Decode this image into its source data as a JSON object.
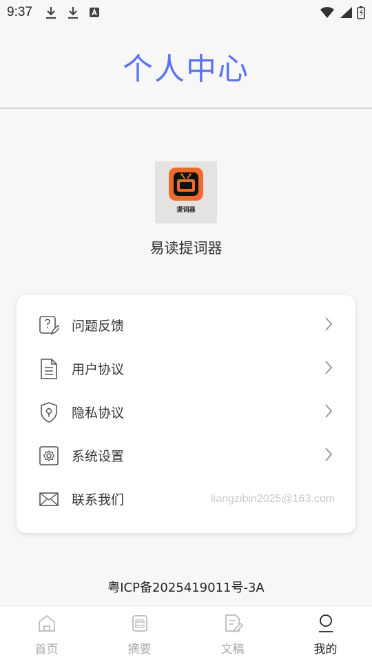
{
  "status_bar": {
    "time": "9:37",
    "left_icons": [
      "download-icon",
      "download-icon",
      "font-a-icon"
    ],
    "right_icons": [
      "wifi-icon",
      "signal-icon",
      "battery-icon"
    ]
  },
  "header": {
    "title": "个人中心"
  },
  "app": {
    "logo_caption": "提词器",
    "name": "易读提词器"
  },
  "menu": {
    "items": [
      {
        "icon": "feedback-icon",
        "label": "问题反馈",
        "has_chevron": true
      },
      {
        "icon": "document-icon",
        "label": "用户协议",
        "has_chevron": true
      },
      {
        "icon": "shield-icon",
        "label": "隐私协议",
        "has_chevron": true
      },
      {
        "icon": "settings-icon",
        "label": "系统设置",
        "has_chevron": true
      },
      {
        "icon": "mail-icon",
        "label": "联系我们",
        "value": "liangzibin2025@163.com"
      }
    ]
  },
  "footer": {
    "icp": "粤ICP备2025419011号-3A"
  },
  "bottom_nav": {
    "items": [
      {
        "icon": "home-icon",
        "label": "首页"
      },
      {
        "icon": "summary-icon",
        "label": "摘要"
      },
      {
        "icon": "draft-icon",
        "label": "文稿"
      },
      {
        "icon": "user-icon",
        "label": "我的"
      }
    ],
    "active": "我的"
  },
  "colors": {
    "accent": "#5b74f0",
    "logo_orange": "#f06a2b",
    "muted": "#aaaaaa",
    "email": "#c8c8c8"
  }
}
